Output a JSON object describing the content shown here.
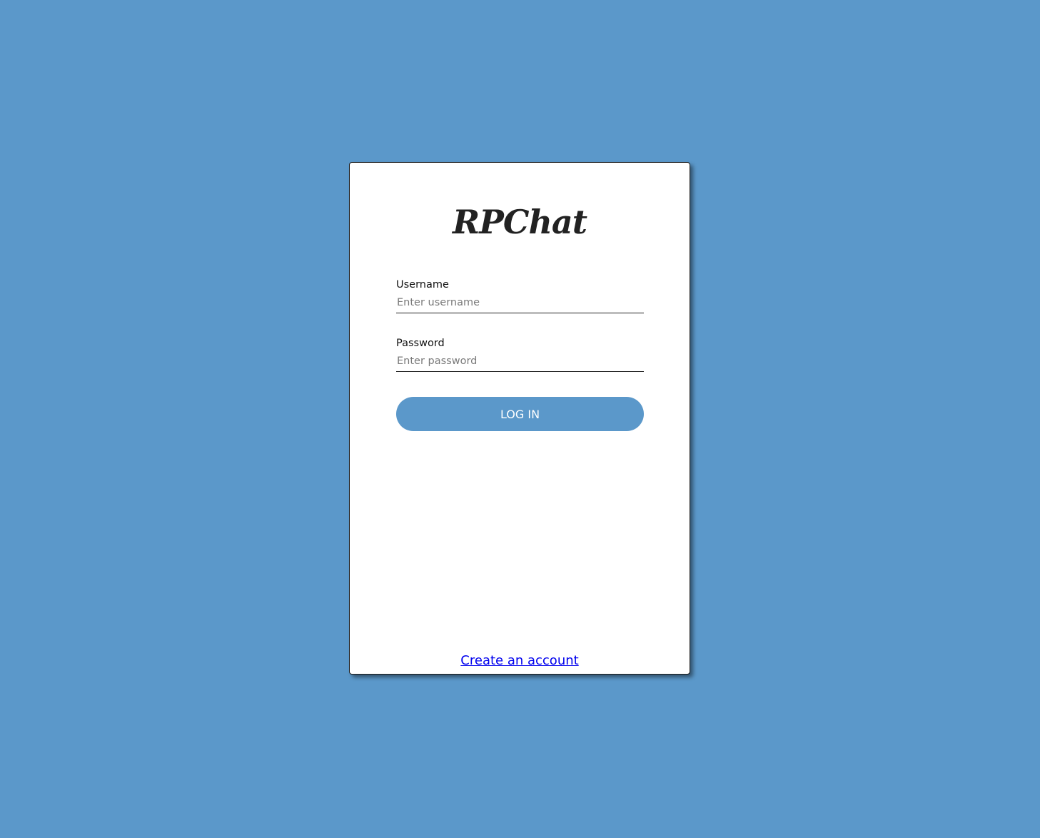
{
  "app": {
    "logo": "RPChat"
  },
  "form": {
    "username_label": "Username",
    "username_placeholder": "Enter username",
    "password_label": "Password",
    "password_placeholder": "Enter password",
    "login_label": "LOG IN"
  },
  "footer": {
    "create_account_label": "Create an account"
  },
  "colors": {
    "background": "#5b98ca",
    "button": "#5b98ca",
    "card": "#ffffff",
    "link": "#0000ee"
  }
}
